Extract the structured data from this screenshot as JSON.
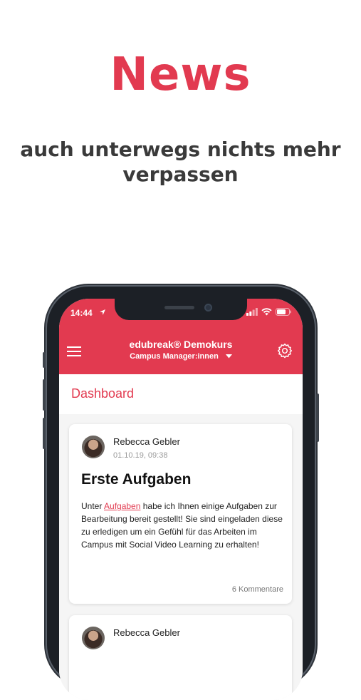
{
  "hero": {
    "title": "News",
    "subtitle": "auch unterwegs nichts mehr verpassen"
  },
  "status_bar": {
    "time": "14:44"
  },
  "app_bar": {
    "title": "edubreak® Demokurs",
    "subtitle": "Campus Manager:innen",
    "menu_icon": "hamburger-menu-icon",
    "settings_icon": "gear-icon",
    "dropdown_icon": "caret-down-icon"
  },
  "page": {
    "title": "Dashboard"
  },
  "posts": [
    {
      "author": "Rebecca Gebler",
      "date": "01.10.19, 09:38",
      "title": "Erste Aufgaben",
      "body_before": "Unter ",
      "body_link": "Aufgaben",
      "body_after": " habe ich Ihnen einige Aufgaben zur Bearbeitung bereit gestellt! Sie sind eingeladen diese zu erledigen um ein Gefühl für das Arbeiten im Campus mit Social Video Learning zu erhalten!",
      "comments": "6 Kommentare"
    },
    {
      "author": "Rebecca Gebler"
    }
  ],
  "colors": {
    "accent": "#e23a50",
    "phone_frame": "#1c2026",
    "text_dark": "#3a3a3a"
  }
}
